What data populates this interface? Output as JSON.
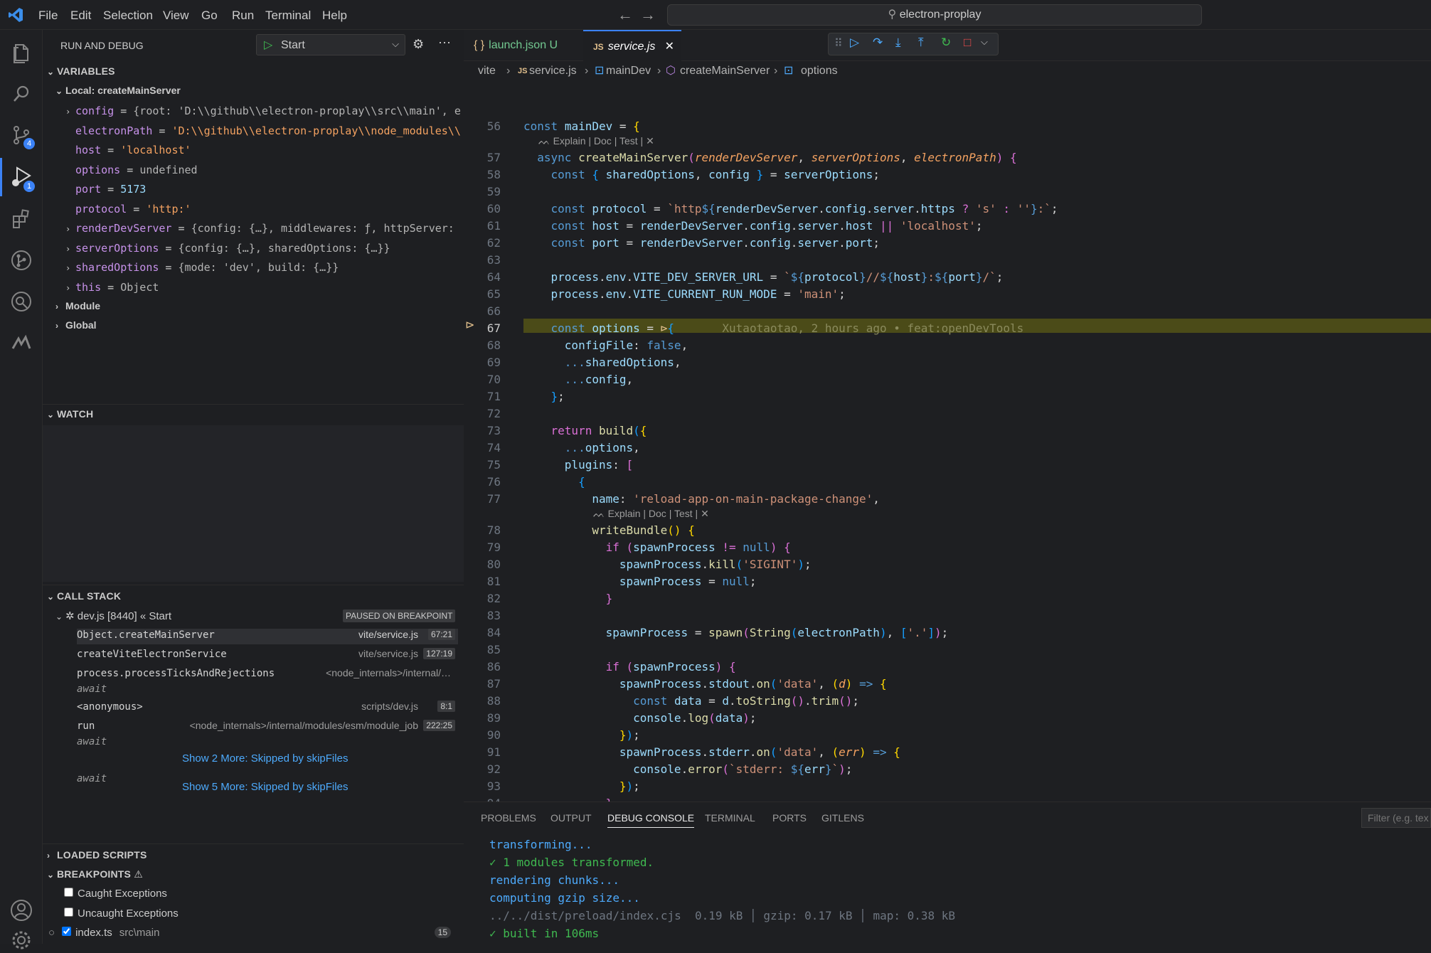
{
  "titlebar": {
    "menu": [
      "File",
      "Edit",
      "Selection",
      "View",
      "Go",
      "Run",
      "Terminal",
      "Help"
    ],
    "search_text": "electron-proplay"
  },
  "activity": {
    "scm_badge": "4",
    "debug_badge": "1"
  },
  "sidebar": {
    "title": "RUN AND DEBUG",
    "config_name": "Start",
    "variables_header": "VARIABLES",
    "local_scope": "Local: createMainServer",
    "vars": [
      {
        "name": "config",
        "value": "{root: 'D:\\\\github\\\\electron-proplay\\\\src\\\\main', e…",
        "expandable": true
      },
      {
        "name": "electronPath",
        "value": "'D:\\\\github\\\\electron-proplay\\\\node_modules\\\\…",
        "expandable": false
      },
      {
        "name": "host",
        "value": "'localhost'",
        "expandable": false
      },
      {
        "name": "options",
        "value": "undefined",
        "expandable": false
      },
      {
        "name": "port",
        "value": "5173",
        "expandable": false
      },
      {
        "name": "protocol",
        "value": "'http:'",
        "expandable": false
      },
      {
        "name": "renderDevServer",
        "value": "{config: {…}, middlewares: ƒ, httpServer: …",
        "expandable": true
      },
      {
        "name": "serverOptions",
        "value": "{config: {…}, sharedOptions: {…}}",
        "expandable": true
      },
      {
        "name": "sharedOptions",
        "value": "{mode: 'dev', build: {…}}",
        "expandable": true
      },
      {
        "name": "this",
        "value": "Object",
        "expandable": true
      }
    ],
    "module_scope": "Module",
    "global_scope": "Global",
    "watch_header": "WATCH",
    "callstack_header": "CALL STACK",
    "thread_name": "dev.js [8440] « Start",
    "thread_status": "PAUSED ON BREAKPOINT",
    "frames": [
      {
        "name": "Object.createMainServer",
        "file": "vite/service.js",
        "pos": "67:21"
      },
      {
        "name": "createViteElectronService",
        "file": "vite/service.js",
        "pos": "127:19"
      },
      {
        "name": "process.processTicksAndRejections",
        "file": "<node_internals>/internal/…",
        "pos": ""
      },
      {
        "name": "await",
        "file": "",
        "pos": ""
      },
      {
        "name": "<anonymous>",
        "file": "scripts/dev.js",
        "pos": "8:1"
      },
      {
        "name": "run",
        "file": "<node_internals>/internal/modules/esm/module_job",
        "pos": "222:25"
      },
      {
        "name": "await",
        "file": "",
        "pos": ""
      }
    ],
    "skip1": "Show 2 More: Skipped by skipFiles",
    "await3": "await",
    "skip2": "Show 5 More: Skipped by skipFiles",
    "loaded_scripts_header": "LOADED SCRIPTS",
    "breakpoints_header": "BREAKPOINTS",
    "bp_caught": "Caught Exceptions",
    "bp_uncaught": "Uncaught Exceptions",
    "bp_file": "index.ts",
    "bp_dir": "src\\main",
    "bp_line": "15"
  },
  "editor": {
    "tabs": [
      {
        "label": "launch.json",
        "status": "U",
        "icon": "{ }"
      },
      {
        "label": "service.js",
        "status": "",
        "icon": "JS"
      }
    ],
    "breadcrumbs": [
      "vite",
      "service.js",
      "mainDev",
      "createMainServer",
      "options"
    ],
    "lens": "Explain | Doc | Test |",
    "blame": "Xutaotaotao, 2 hours ago • feat:openDevTools"
  },
  "panel": {
    "tabs": [
      "PROBLEMS",
      "OUTPUT",
      "DEBUG CONSOLE",
      "TERMINAL",
      "PORTS",
      "GITLENS"
    ],
    "filter_placeholder": "Filter (e.g. tex",
    "console": [
      "transforming...",
      "✓ 1 modules transformed.",
      "rendering chunks...",
      "computing gzip size...",
      "../../dist/preload/index.cjs  0.19 kB │ gzip: 0.17 kB │ map: 0.38 kB",
      "✓ built in 106ms"
    ]
  },
  "colors": {
    "accent": "#3b82f6",
    "highlight": "#4b4b18",
    "breakpoint": "#e2c08d"
  }
}
